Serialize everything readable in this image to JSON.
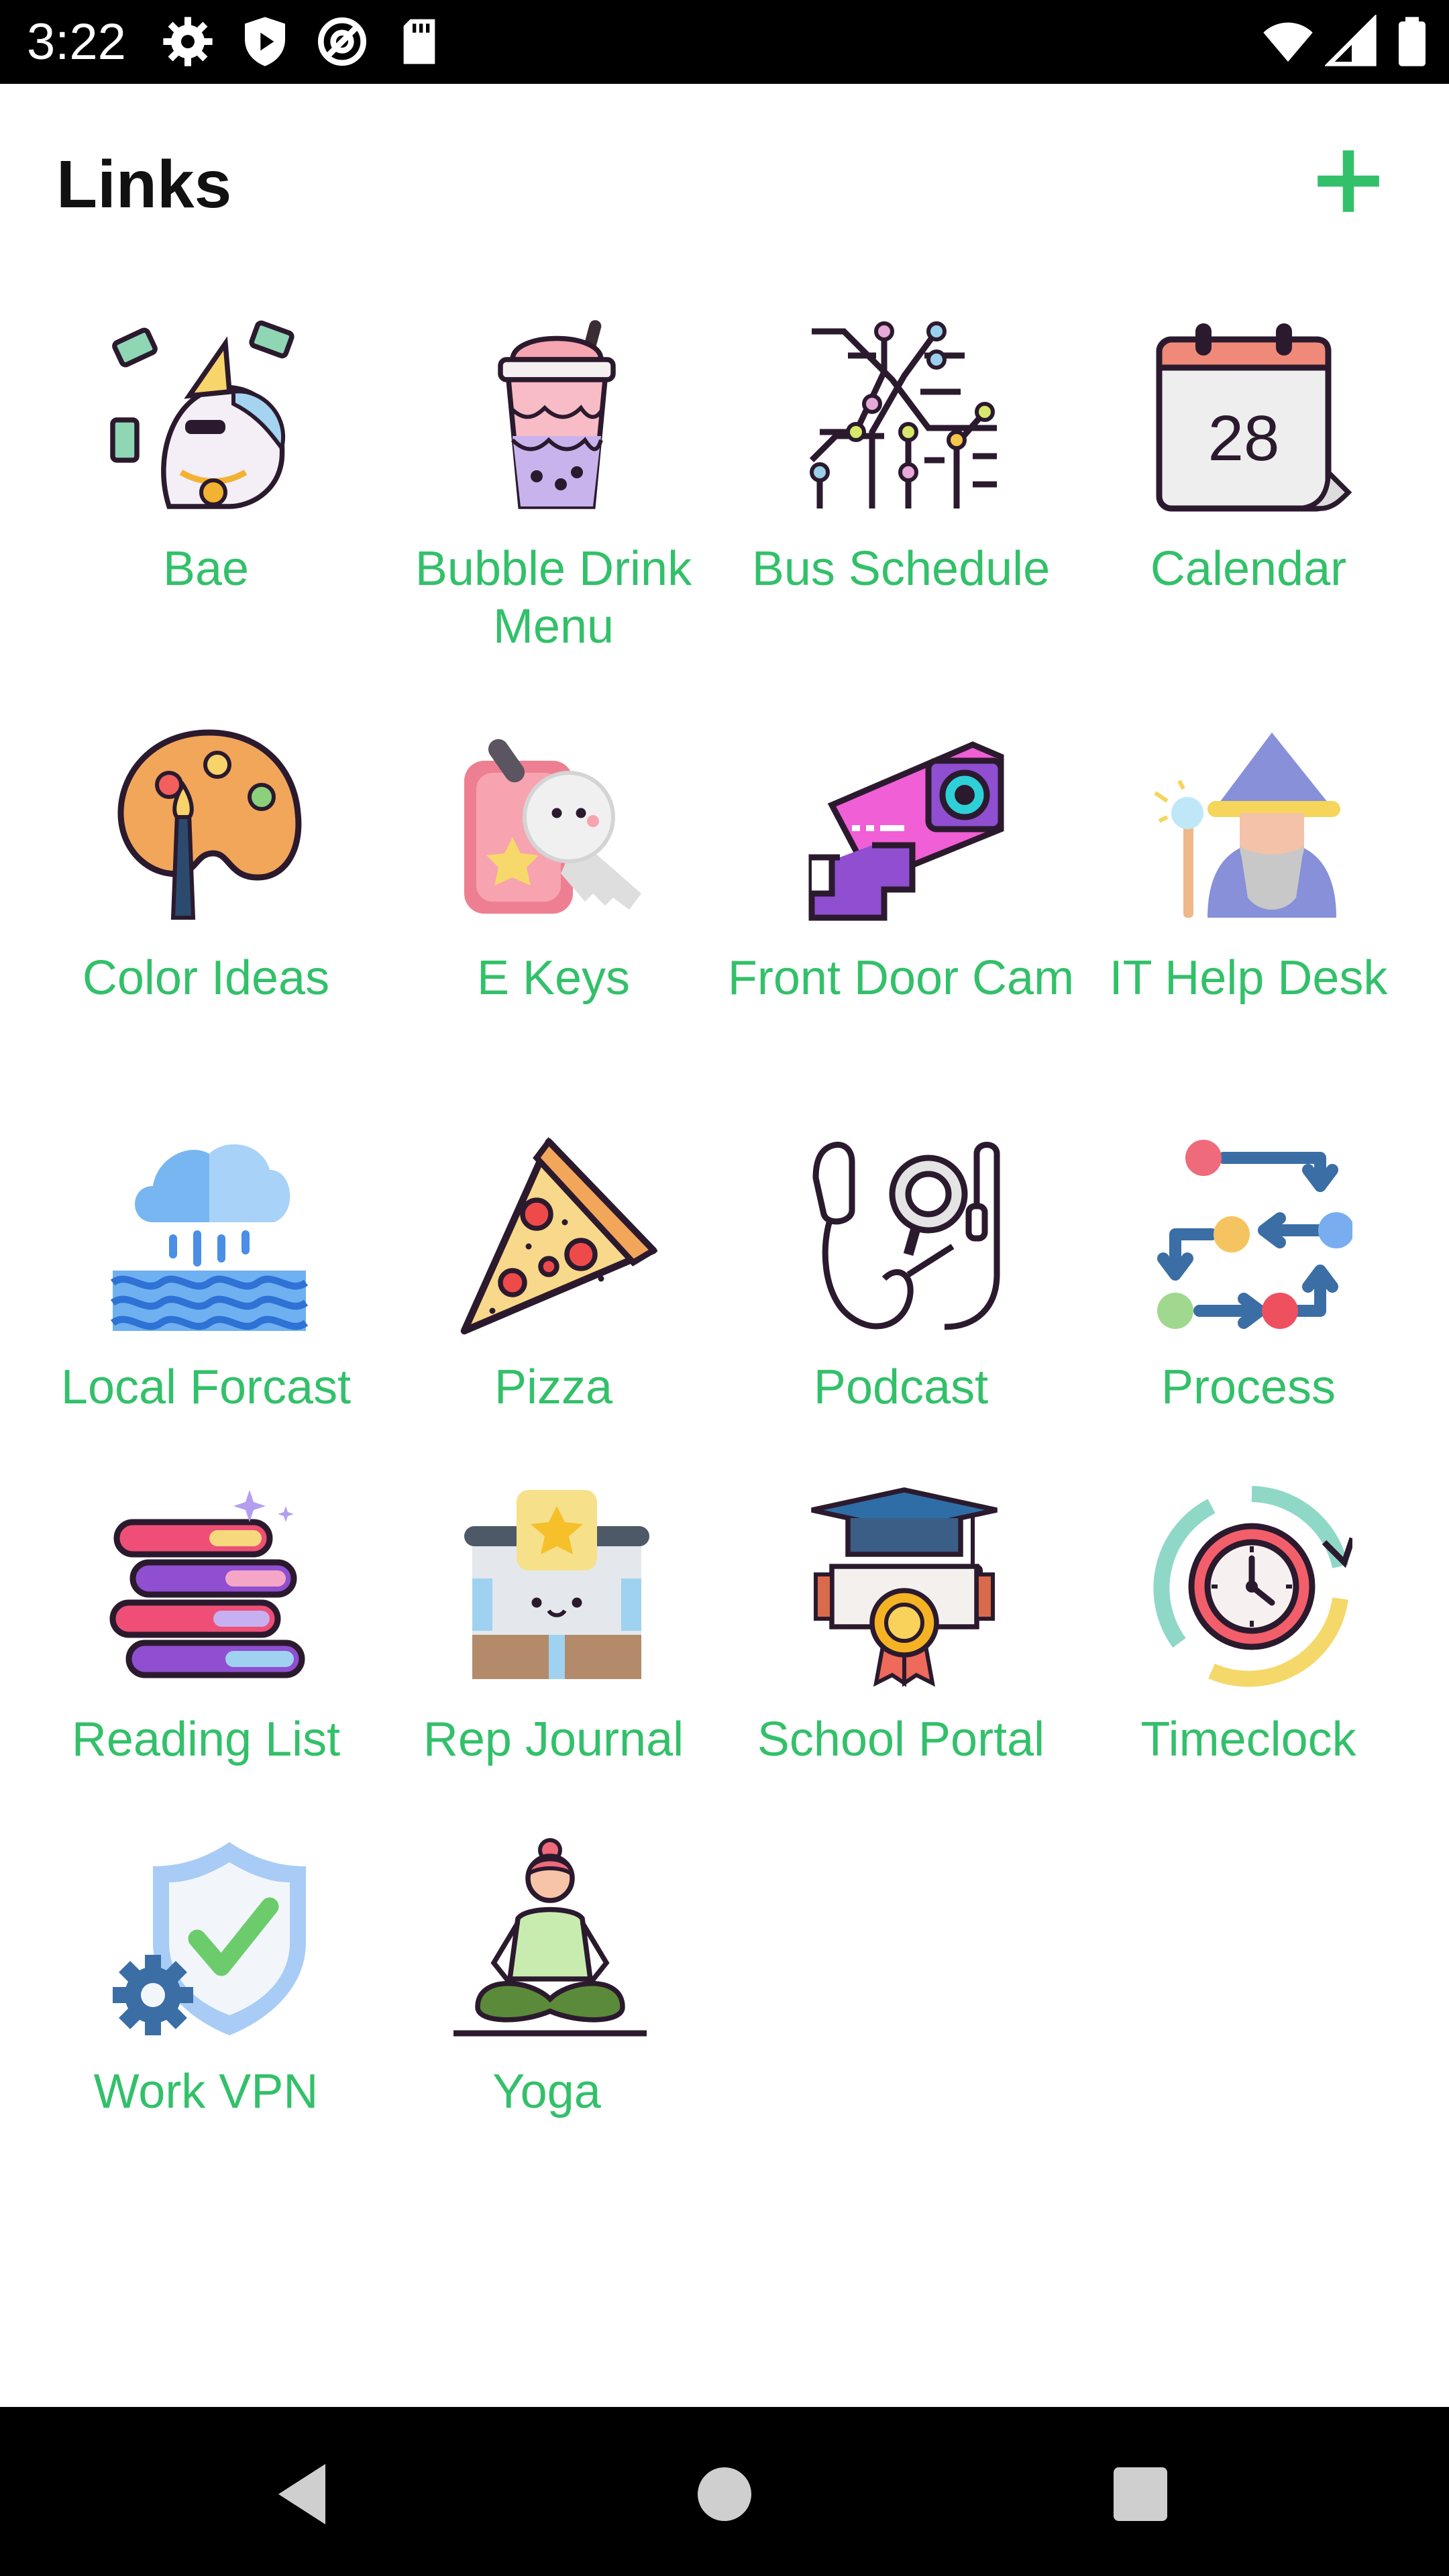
{
  "status_bar": {
    "time": "3:22",
    "left_icons": [
      "gear-icon",
      "play-protect-icon",
      "at-sign-icon",
      "sd-card-icon"
    ],
    "right_icons": [
      "wifi-icon",
      "cell-signal-icon",
      "battery-icon"
    ]
  },
  "header": {
    "title": "Links",
    "add_icon": "plus-icon",
    "accent_color": "#33c06a"
  },
  "links": [
    {
      "label": "Bae",
      "icon": "unicorn-money-icon"
    },
    {
      "label": "Bubble Drink Menu",
      "icon": "bubble-drink-icon"
    },
    {
      "label": "Bus Schedule",
      "icon": "transit-map-icon"
    },
    {
      "label": "Calendar",
      "icon": "calendar-icon",
      "icon_text": "28"
    },
    {
      "label": "Color Ideas",
      "icon": "palette-icon"
    },
    {
      "label": "E Keys",
      "icon": "keys-icon"
    },
    {
      "label": "Front Door Cam",
      "icon": "security-camera-icon"
    },
    {
      "label": "IT Help Desk",
      "icon": "wizard-icon"
    },
    {
      "label": "Local Forcast",
      "icon": "rain-cloud-icon"
    },
    {
      "label": "Pizza",
      "icon": "pizza-icon"
    },
    {
      "label": "Podcast",
      "icon": "earphones-icon"
    },
    {
      "label": "Process",
      "icon": "process-flow-icon"
    },
    {
      "label": "Reading List",
      "icon": "books-icon"
    },
    {
      "label": "Rep Journal",
      "icon": "journal-icon"
    },
    {
      "label": "School Portal",
      "icon": "graduation-cap-icon"
    },
    {
      "label": "Timeclock",
      "icon": "clock-icon"
    },
    {
      "label": "Work VPN",
      "icon": "shield-gear-icon"
    },
    {
      "label": "Yoga",
      "icon": "yoga-icon"
    }
  ],
  "nav_bar": {
    "back_icon": "back-triangle-icon",
    "home_icon": "home-circle-icon",
    "recents_icon": "recents-square-icon"
  }
}
